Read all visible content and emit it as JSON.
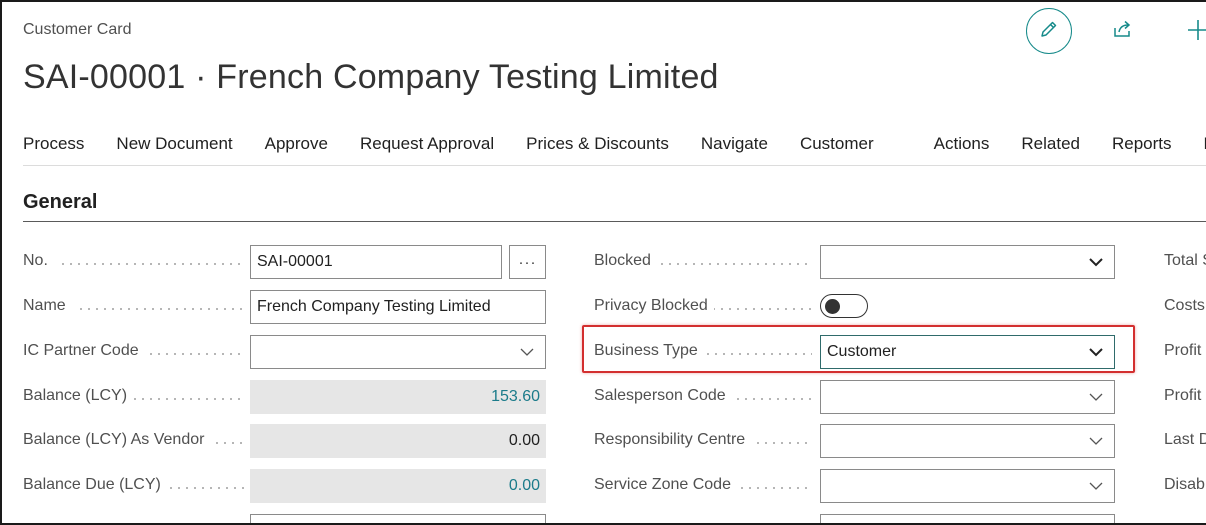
{
  "header": {
    "breadcrumb": "Customer Card",
    "title": "SAI-00001 · French Company Testing Limited"
  },
  "actionbar": {
    "items": [
      "Process",
      "New Document",
      "Approve",
      "Request Approval",
      "Prices & Discounts",
      "Navigate",
      "Customer"
    ],
    "secondary_items": [
      "Actions",
      "Related",
      "Reports",
      "Fe"
    ]
  },
  "section": {
    "title": "General"
  },
  "left_fields": {
    "no": {
      "label": "No.",
      "value": "SAI-00001",
      "assist": "···"
    },
    "name": {
      "label": "Name",
      "value": "French Company Testing Limited"
    },
    "ic_partner_code": {
      "label": "IC Partner Code",
      "value": ""
    },
    "balance_lcy": {
      "label": "Balance (LCY)",
      "value": "153.60"
    },
    "balance_lcy_vendor": {
      "label": "Balance (LCY) As Vendor",
      "value": "0.00"
    },
    "balance_due_lcy": {
      "label": "Balance Due (LCY)",
      "value": "0.00"
    }
  },
  "middle_fields": {
    "blocked": {
      "label": "Blocked",
      "value": ""
    },
    "privacy_blocked": {
      "label": "Privacy Blocked",
      "value": false
    },
    "business_type": {
      "label": "Business Type",
      "value": "Customer"
    },
    "salesperson_code": {
      "label": "Salesperson Code",
      "value": ""
    },
    "responsibility_centre": {
      "label": "Responsibility Centre",
      "value": ""
    },
    "service_zone_code": {
      "label": "Service Zone Code",
      "value": ""
    }
  },
  "right_fields": {
    "labels": [
      "Total S",
      "Costs",
      "Profit",
      "Profit",
      "Last D",
      "Disab"
    ]
  },
  "colors": {
    "accent": "#168a8a",
    "link_value": "#1b7b8a",
    "highlight": "#d32f2f"
  }
}
